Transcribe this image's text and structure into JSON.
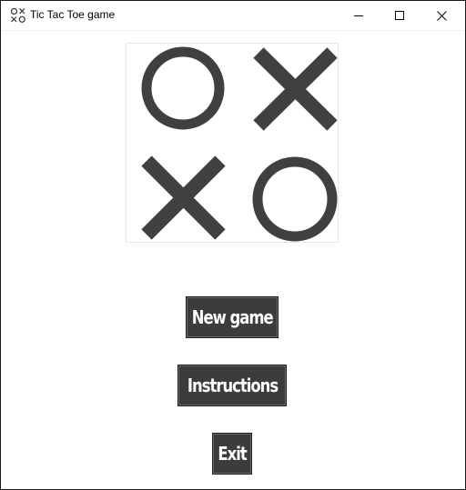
{
  "window": {
    "title": "Tic Tac Toe game",
    "controls": {
      "minimize": "minimize-icon",
      "maximize": "maximize-icon",
      "close": "close-icon"
    }
  },
  "logo": {
    "cells": [
      "O",
      "X",
      "X",
      "O"
    ],
    "mark_color": "#404040"
  },
  "menu": {
    "new_game": "New game",
    "instructions": "Instructions",
    "exit": "Exit"
  },
  "colors": {
    "button_bg": "#3c3c3c",
    "button_text": "#ffffff",
    "background": "#ffffff"
  }
}
